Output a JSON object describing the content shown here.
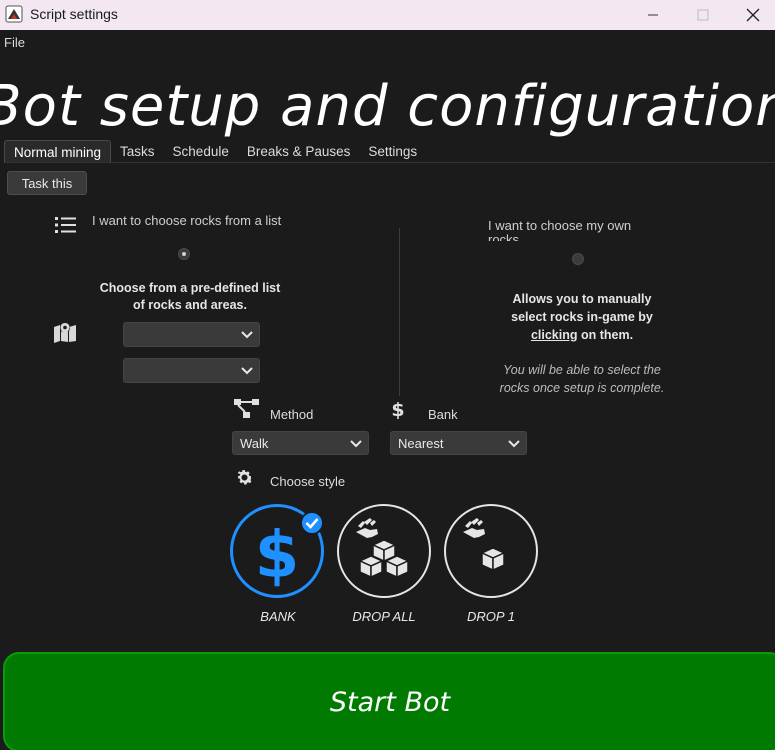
{
  "window": {
    "title": "Script settings"
  },
  "menu": {
    "file": "File"
  },
  "header": {
    "title": "Bot setup and configuration"
  },
  "tabs": [
    {
      "label": "Normal mining",
      "active": true
    },
    {
      "label": "Tasks"
    },
    {
      "label": "Schedule"
    },
    {
      "label": "Breaks & Pauses"
    },
    {
      "label": "Settings"
    }
  ],
  "task_button": "Task this",
  "left_option": {
    "radio_label": "I want to choose rocks from a list",
    "selected": true,
    "description_line1": "Choose from a pre-defined list",
    "description_line2": "of rocks and areas.",
    "dropdown1_value": "",
    "dropdown2_value": ""
  },
  "right_option": {
    "radio_label": "I want to choose my own rocks",
    "selected": false,
    "desc_line1": "Allows you to manually",
    "desc_line2": "select rocks in-game by",
    "desc_link": "clicking",
    "desc_line3_rest": " on them.",
    "note_line1": "You will be able to select the",
    "note_line2": "rocks once setup is complete."
  },
  "method": {
    "label": "Method",
    "value": "Walk"
  },
  "bank": {
    "label": "Bank",
    "value": "Nearest"
  },
  "style": {
    "label": "Choose style",
    "options": [
      {
        "label": "BANK",
        "selected": true,
        "icon": "dollar-icon"
      },
      {
        "label": "DROP ALL",
        "selected": false,
        "icon": "hand-drop-all-icon"
      },
      {
        "label": "DROP 1",
        "selected": false,
        "icon": "hand-drop-one-icon"
      }
    ]
  },
  "start_button": "Start Bot",
  "colors": {
    "accent": "#1e90ff",
    "start": "#007a00"
  }
}
